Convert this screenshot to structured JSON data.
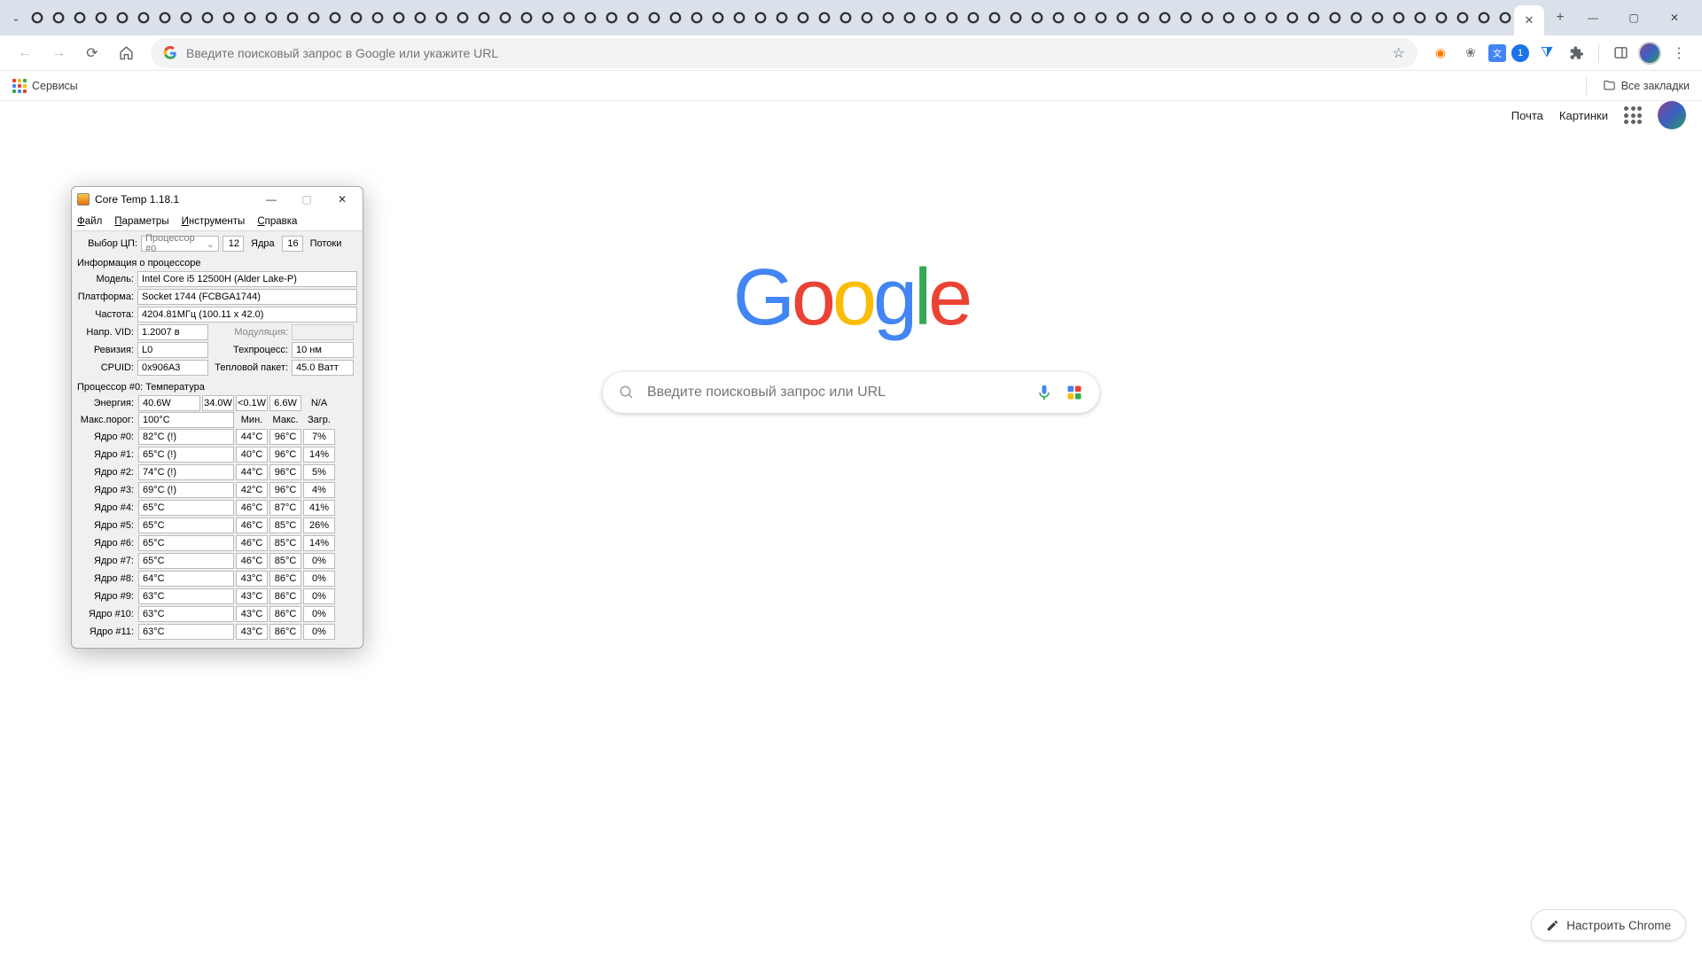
{
  "chrome": {
    "tab_count": 70,
    "omnibox_placeholder": "Введите поисковый запрос в Google или укажите URL",
    "bookmarks_services": "Сервисы",
    "bookmarks_all": "Все закладки",
    "ntp_mail": "Почта",
    "ntp_images": "Картинки",
    "search_placeholder": "Введите поисковый запрос или URL",
    "customize": "Настроить Chrome",
    "ext_badge": "1"
  },
  "ct": {
    "title": "Core Temp 1.18.1",
    "menu": {
      "file": "Файл",
      "params": "Параметры",
      "tools": "Инструменты",
      "help": "Справка"
    },
    "cpu_select_label": "Выбор ЦП:",
    "cpu_select_value": "Процессор #0",
    "cores_label": "Ядра",
    "cores": "12",
    "threads_label": "Потоки",
    "threads": "16",
    "info_section": "Информация о процессоре",
    "model_label": "Модель:",
    "model": "Intel Core i5 12500H (Alder Lake-P)",
    "platform_label": "Платформа:",
    "platform": "Socket 1744 (FCBGA1744)",
    "freq_label": "Частота:",
    "freq": "4204.81МГц (100.11 x 42.0)",
    "vid_label": "Напр. VID:",
    "vid": "1.2007 в",
    "mod_label": "Модуляция:",
    "mod": "",
    "rev_label": "Ревизия:",
    "rev": "L0",
    "lith_label": "Техпроцесс:",
    "lith": "10 нм",
    "cpuid_label": "CPUID:",
    "cpuid": "0x906A3",
    "tdp_label": "Тепловой пакет:",
    "tdp": "45.0 Ватт",
    "temp_section": "Процессор #0: Температура",
    "energy_label": "Энергия:",
    "energy": [
      "40.6W",
      "34.0W",
      "<0.1W",
      "6.6W",
      "N/A"
    ],
    "max_label": "Макс.порог:",
    "max_val": "100°C",
    "col_min": "Мин.",
    "col_max": "Макс.",
    "col_load": "Загр.",
    "cores_data": [
      {
        "label": "Ядро #0:",
        "cur": "82°C (!)",
        "min": "44°C",
        "max": "96°C",
        "load": "7%"
      },
      {
        "label": "Ядро #1:",
        "cur": "65°C (!)",
        "min": "40°C",
        "max": "96°C",
        "load": "14%"
      },
      {
        "label": "Ядро #2:",
        "cur": "74°C (!)",
        "min": "44°C",
        "max": "96°C",
        "load": "5%"
      },
      {
        "label": "Ядро #3:",
        "cur": "69°C (!)",
        "min": "42°C",
        "max": "96°C",
        "load": "4%"
      },
      {
        "label": "Ядро #4:",
        "cur": "65°C",
        "min": "46°C",
        "max": "87°C",
        "load": "41%"
      },
      {
        "label": "Ядро #5:",
        "cur": "65°C",
        "min": "46°C",
        "max": "85°C",
        "load": "26%"
      },
      {
        "label": "Ядро #6:",
        "cur": "65°C",
        "min": "46°C",
        "max": "85°C",
        "load": "14%"
      },
      {
        "label": "Ядро #7:",
        "cur": "65°C",
        "min": "46°C",
        "max": "85°C",
        "load": "0%"
      },
      {
        "label": "Ядро #8:",
        "cur": "64°C",
        "min": "43°C",
        "max": "86°C",
        "load": "0%"
      },
      {
        "label": "Ядро #9:",
        "cur": "63°C",
        "min": "43°C",
        "max": "86°C",
        "load": "0%"
      },
      {
        "label": "Ядро #10:",
        "cur": "63°C",
        "min": "43°C",
        "max": "86°C",
        "load": "0%"
      },
      {
        "label": "Ядро #11:",
        "cur": "63°C",
        "min": "43°C",
        "max": "86°C",
        "load": "0%"
      }
    ]
  }
}
